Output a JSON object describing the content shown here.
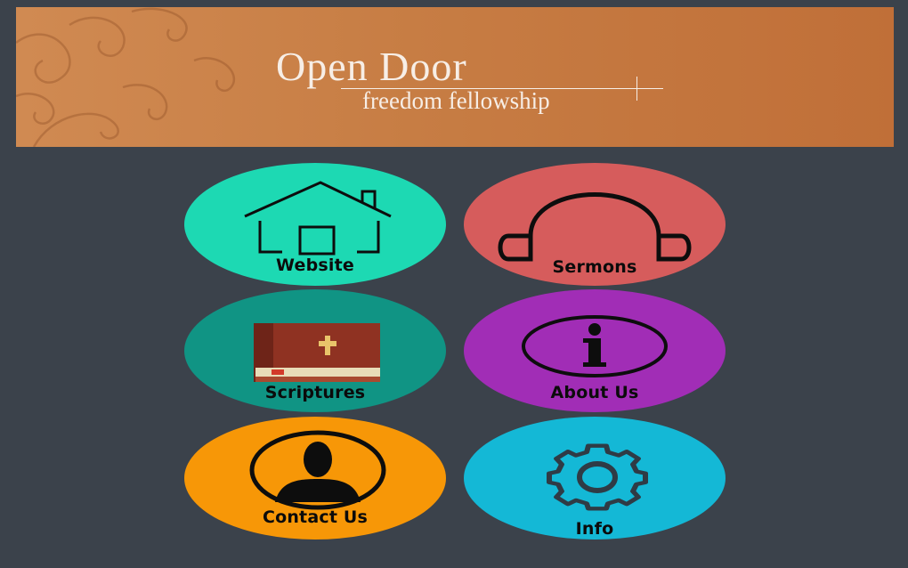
{
  "header": {
    "title": "Open Door",
    "subtitle": "freedom fellowship"
  },
  "tiles": [
    {
      "label": "Website",
      "color": "#1dd9b3",
      "icon": "house-icon"
    },
    {
      "label": "Sermons",
      "color": "#d65c5c",
      "icon": "headphones-icon"
    },
    {
      "label": "Scriptures",
      "color": "#109484",
      "icon": "bible-icon"
    },
    {
      "label": "About Us",
      "color": "#a12db6",
      "icon": "info-icon"
    },
    {
      "label": "Contact Us",
      "color": "#f79707",
      "icon": "person-icon"
    },
    {
      "label": "Info",
      "color": "#14b8d6",
      "icon": "gear-icon"
    }
  ]
}
